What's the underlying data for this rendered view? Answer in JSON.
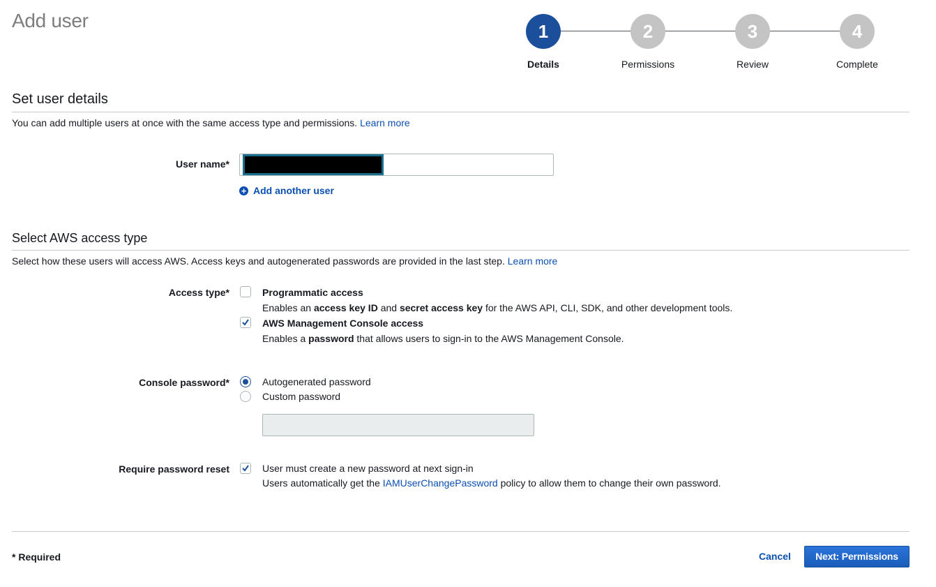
{
  "page": {
    "title": "Add user"
  },
  "stepper": {
    "steps": [
      {
        "number": "1",
        "label": "Details",
        "state": "active"
      },
      {
        "number": "2",
        "label": "Permissions",
        "state": "inactive"
      },
      {
        "number": "3",
        "label": "Review",
        "state": "inactive"
      },
      {
        "number": "4",
        "label": "Complete",
        "state": "inactive"
      }
    ]
  },
  "user_details": {
    "title": "Set user details",
    "description": "You can add multiple users at once with the same access type and permissions.",
    "learn_more": "Learn more",
    "user_name_label": "User name*",
    "user_name_value": "",
    "add_another_user": "Add another user"
  },
  "access_type": {
    "title": "Select AWS access type",
    "description": "Select how these users will access AWS. Access keys and autogenerated passwords are provided in the last step.",
    "learn_more": "Learn more",
    "label": "Access type*",
    "programmatic": {
      "title": "Programmatic access",
      "checked": false,
      "desc_part1": "Enables an ",
      "desc_bold1": "access key ID",
      "desc_part2": " and ",
      "desc_bold2": "secret access key",
      "desc_part3": " for the AWS API, CLI, SDK, and other development tools."
    },
    "console": {
      "title": "AWS Management Console access",
      "checked": true,
      "desc_part1": "Enables a ",
      "desc_bold1": "password",
      "desc_part2": " that allows users to sign-in to the AWS Management Console."
    }
  },
  "console_password": {
    "label": "Console password*",
    "options": [
      {
        "label": "Autogenerated password",
        "selected": true
      },
      {
        "label": "Custom password",
        "selected": false
      }
    ],
    "custom_value": ""
  },
  "password_reset": {
    "label": "Require password reset",
    "checked": true,
    "text": "User must create a new password at next sign-in",
    "desc_part1": "Users automatically get the ",
    "policy_link": "IAMUserChangePassword",
    "desc_part2": " policy to allow them to change their own password."
  },
  "footer": {
    "required_note": "* Required",
    "cancel": "Cancel",
    "next": "Next: Permissions"
  },
  "colors": {
    "primary": "#1b4f9c",
    "link": "#0b4fb3",
    "inactive_step": "#c4c4c4",
    "button": "#1f6dd6"
  }
}
